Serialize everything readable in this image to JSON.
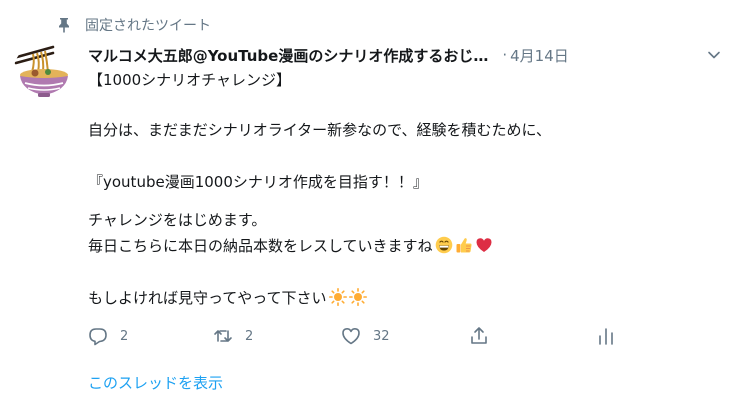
{
  "pinned": {
    "label": "固定されたツイート"
  },
  "tweet": {
    "display_name": "マルコメ大五郎@YouTube漫画のシナリオ作成するおじ…",
    "separator": "·",
    "date": "4月14日",
    "title_line": "【1000シナリオチャレンジ】",
    "line_1": "自分は、まだまだシナリオライター新参なので、経験を積むために、",
    "line_2": "『youtube漫画1000シナリオ作成を目指す！！』",
    "line_3": "チャレンジをはじめます。",
    "line_4": "毎日こちらに本日の納品本数をレスしていきますね",
    "line_5": "もしよければ見守ってやって下さい",
    "line_4_emojis": [
      "grinning-face-icon",
      "thumbs-up-icon",
      "red-heart-icon"
    ],
    "line_5_emojis": [
      "sun-icon",
      "sun-icon"
    ]
  },
  "actions": {
    "reply_count": "2",
    "retweet_count": "2",
    "like_count": "32"
  },
  "show_thread": {
    "label": "このスレッドを表示"
  },
  "colors": {
    "text": "#14171a",
    "secondary": "#657786",
    "link": "#1da1f2",
    "heart": "#e0245e"
  }
}
